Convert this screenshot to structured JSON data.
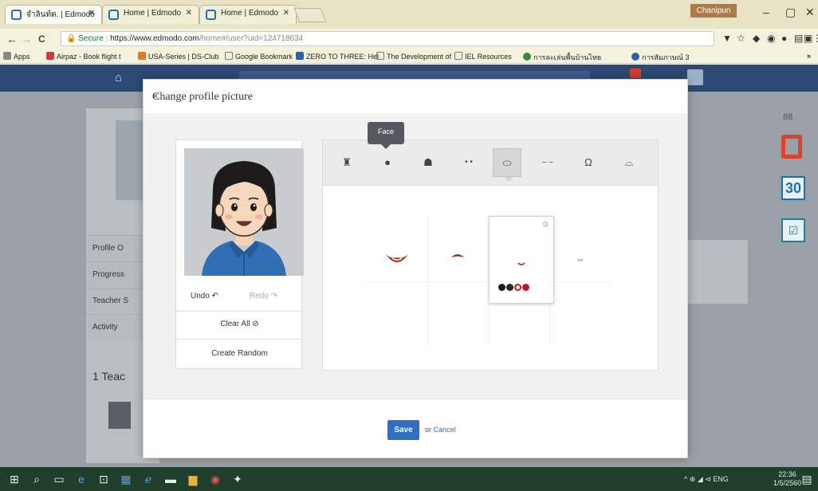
{
  "browser": {
    "tabs": [
      {
        "title": "จำลินท์ต. | Edmodo",
        "active": true
      },
      {
        "title": "Home | Edmodo",
        "active": false
      },
      {
        "title": "Home | Edmodo",
        "active": false
      }
    ],
    "user": "Chanipun",
    "window_controls": {
      "minimize": "–",
      "maximize": "▢",
      "close": "✕"
    },
    "nav": {
      "back": "←",
      "forward": "→",
      "reload": "C"
    },
    "url": {
      "secure_label": "🔒 Secure",
      "host": "https://www.edmodo.com",
      "path": "/home#/user?uid=124718634"
    },
    "extensions": [
      "▼",
      "☆",
      "◆",
      "◉",
      "●",
      "▤",
      "▣",
      "⋮"
    ],
    "bookmarks": [
      {
        "label": "Apps",
        "color": "#888888"
      },
      {
        "label": "Airpaz - Book flight t",
        "color": "#d23c3c"
      },
      {
        "label": "USA-Series | DS-Club",
        "color": "#e07a20"
      },
      {
        "label": "Google Bookmark",
        "color": "#777777"
      },
      {
        "label": "ZERO TO THREE: Hel",
        "color": "#2a62b0"
      },
      {
        "label": "The Development of",
        "color": "#777777"
      },
      {
        "label": "IEL Resources",
        "color": "#777777"
      },
      {
        "label": "การละเล่นพื้นบ้านไทย",
        "color": "#3a8a3a"
      },
      {
        "label": "การสัมภาษณ์ 3",
        "color": "#2a62b0"
      }
    ]
  },
  "edmodo": {
    "sidebar": [
      "Profile O",
      "Progress",
      "Teacher S",
      "Activity"
    ],
    "teachers_heading": "1 Teac",
    "right_apps": [
      "88",
      "30",
      "☑"
    ]
  },
  "modal": {
    "title": "Change profile picture",
    "close": "×",
    "undo": "Undo ↶",
    "redo": "Redo ↷",
    "clear_all": "Clear All ⊘",
    "create_random": "Create Random",
    "tooltip": "Face",
    "categories": [
      {
        "icon": "♜",
        "name": "background"
      },
      {
        "icon": "●",
        "name": "face"
      },
      {
        "icon": "☗",
        "name": "hair"
      },
      {
        "icon": "• •",
        "name": "eyes"
      },
      {
        "icon": "⬭",
        "name": "mouth",
        "selected": true
      },
      {
        "icon": "‒ ‒",
        "name": "eyebrows"
      },
      {
        "icon": "Ω",
        "name": "ears"
      },
      {
        "icon": "⌓",
        "name": "glasses"
      }
    ],
    "option_swatches": [
      "#1b1b1b",
      "#3a2116",
      "#ffffff",
      "#c4161c"
    ],
    "save": "Save",
    "or": "or",
    "cancel": "Cancel"
  },
  "taskbar": {
    "tray": "^ ⊕ ◢ ⊲ ENG",
    "time": "22:36",
    "date": "1/5/2560"
  }
}
